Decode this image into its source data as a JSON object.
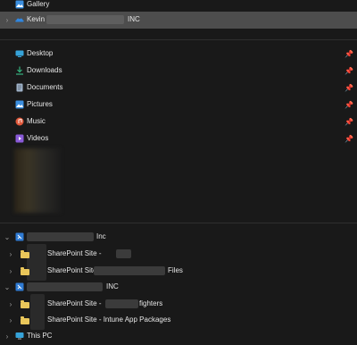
{
  "nav": {
    "gallery": "Gallery",
    "onedrive_prefix": "Kevin",
    "onedrive_suffix": "INC",
    "quick_access": [
      {
        "label": "Desktop",
        "icon": "desktop-icon"
      },
      {
        "label": "Downloads",
        "icon": "download-icon"
      },
      {
        "label": "Documents",
        "icon": "documents-icon"
      },
      {
        "label": "Pictures",
        "icon": "pictures-icon"
      },
      {
        "label": "Music",
        "icon": "music-icon"
      },
      {
        "label": "Videos",
        "icon": "videos-icon"
      }
    ],
    "org1": {
      "suffix": "Inc",
      "sites": [
        {
          "prefix": "SharePoint Site -",
          "suffix": ""
        },
        {
          "prefix": "SharePoint Site -",
          "suffix": "Files"
        }
      ]
    },
    "org2": {
      "suffix": "INC",
      "sites": [
        {
          "prefix": "SharePoint Site -",
          "suffix": "fighters"
        },
        {
          "prefix": "SharePoint Site - Intune App Packages",
          "suffix": ""
        }
      ]
    },
    "this_pc": "This PC"
  },
  "colors": {
    "background": "#191919",
    "selected_row": "#4d4d4d",
    "folder": "#e9c65a",
    "sharepoint": "#2f7bd4"
  }
}
